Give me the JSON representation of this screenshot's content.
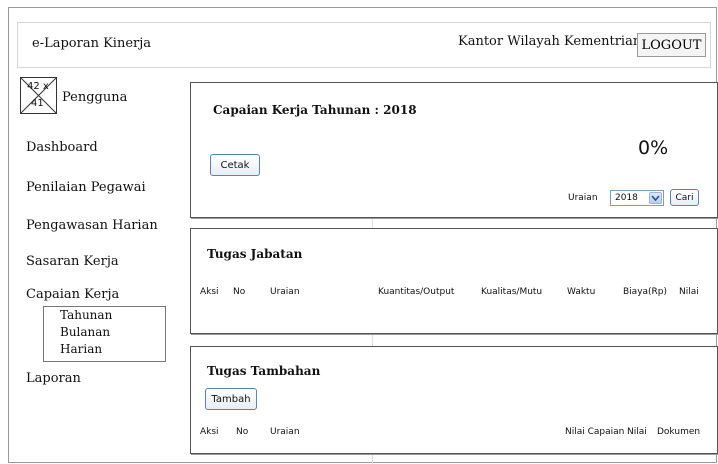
{
  "header": {
    "app_title": "e-Laporan Kinerja",
    "office": "Kantor Wilayah Kementrian Agama",
    "logout_label": "LOGOUT"
  },
  "sidebar": {
    "avatar": {
      "width_text": "42 x",
      "height_text": "41",
      "icon": "image-placeholder-icon"
    },
    "user_label": "Pengguna",
    "items": [
      {
        "label": "Dashboard"
      },
      {
        "label": "Penilaian Pegawai"
      },
      {
        "label": "Pengawasan Harian"
      },
      {
        "label": "Sasaran Kerja"
      },
      {
        "label": "Capaian Kerja"
      },
      {
        "label": "Laporan"
      }
    ],
    "submenu": [
      "Tahunan",
      "Bulanan",
      "Harian"
    ]
  },
  "capaian": {
    "title": "Capaian Kerja Tahunan : 2018",
    "print_label": "Cetak",
    "percent": "0%",
    "uraian_label": "Uraian",
    "year_value": "2018",
    "search_label": "Cari"
  },
  "tugas_jabatan": {
    "title": "Tugas Jabatan",
    "columns": [
      "Aksi",
      "No",
      "Uraian",
      "Kuantitas/Output",
      "Kualitas/Mutu",
      "Waktu",
      "Biaya(Rp)",
      "Nilai"
    ]
  },
  "tugas_tambahan": {
    "title": "Tugas Tambahan",
    "add_label": "Tambah",
    "columns": [
      "Aksi",
      "No",
      "Uraian",
      "Nilai Capaian",
      "Nilai",
      "Dokumen"
    ]
  }
}
